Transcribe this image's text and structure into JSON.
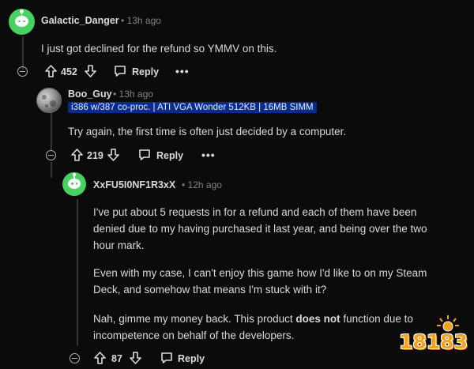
{
  "comments": [
    {
      "username": "Galactic_Danger",
      "time": "• 13h ago",
      "text": "I just got declined for the refund so YMMV on this.",
      "votes": "452",
      "reply_label": "Reply",
      "more_label": "•••"
    },
    {
      "username": "Boo_Guy",
      "time": "• 13h ago",
      "flair": "i386 w/387 co-proc. | ATI VGA Wonder 512KB | 16MB SIMM",
      "text": "Try again, the first time is often just decided by a computer.",
      "votes": "219",
      "reply_label": "Reply",
      "more_label": "•••"
    },
    {
      "username": "XxFU5I0NF1R3xX",
      "time": "• 12h ago",
      "paragraph1_line1": "I've put about 5 requests in for a refund and each of them have been",
      "paragraph1_line2": "denied due to my having purchased it last year, and being over the two",
      "paragraph1_line3": "hour mark.",
      "paragraph2_line1": "Even with my case, I can't enjoy this game how I'd like to on my Steam",
      "paragraph2_line2": "Deck, and somehow that means I'm stuck with it?",
      "paragraph3_line1_before": "Nah, gimme my money back. This product ",
      "paragraph3_line1_bold": "does not",
      "paragraph3_line1_after": " function due to",
      "paragraph3_line2": "incompetence on behalf of the developers.",
      "votes": "87",
      "reply_label": "Reply"
    }
  ],
  "watermark": "18183",
  "icons": {
    "upvote": "upvote-arrow-icon",
    "downvote": "downvote-arrow-icon",
    "reply": "speech-bubble-icon",
    "collapse": "collapse-minus-icon"
  },
  "colors": {
    "background": "#0b0b0b",
    "text": "#d7dadc",
    "muted": "#818384",
    "flair_bg": "#0a2b8e",
    "avatar_green": "#46d160"
  }
}
